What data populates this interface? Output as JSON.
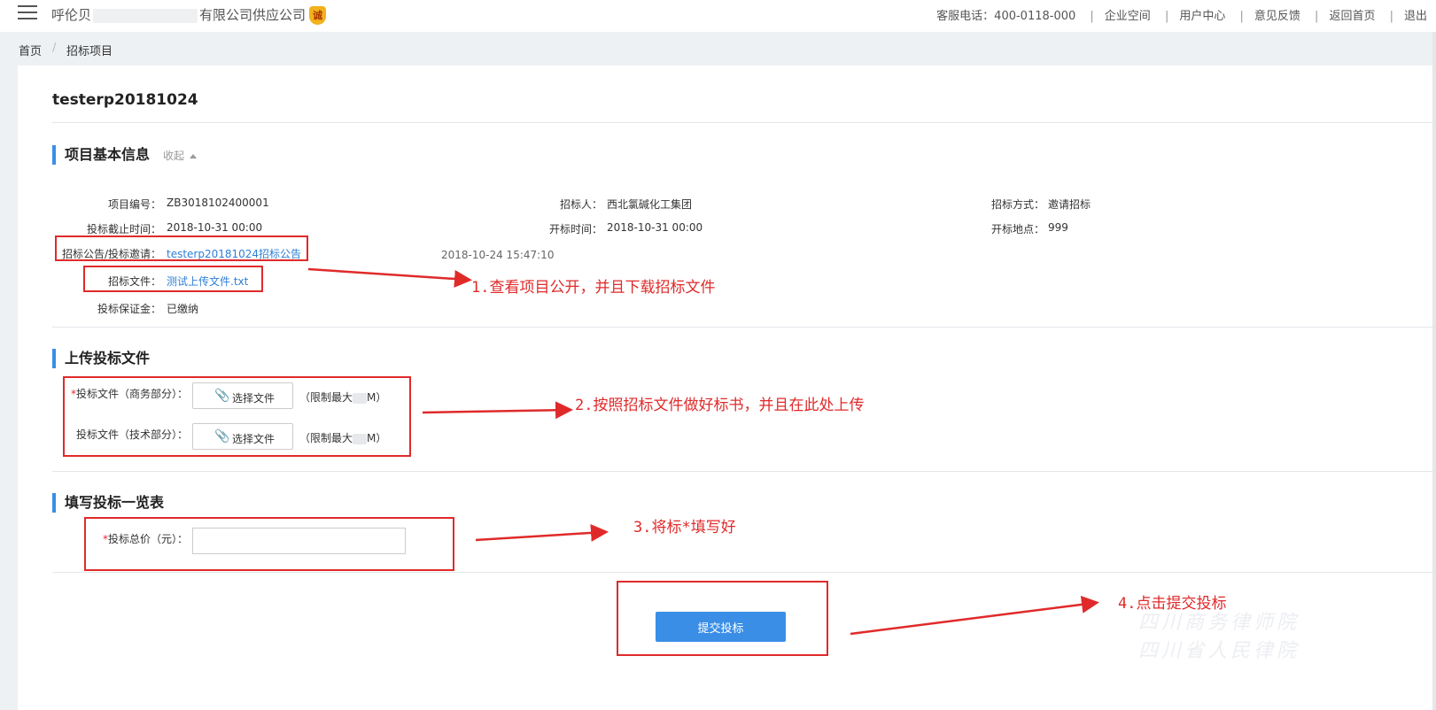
{
  "header": {
    "company_prefix": "呼伦贝",
    "company_suffix": "有限公司供应公司",
    "badge": "诚",
    "hotline": "客服电话：400-0118-000",
    "nav": [
      "企业空间",
      "用户中心",
      "意见反馈",
      "返回首页",
      "退出"
    ]
  },
  "breadcrumb": {
    "home": "首页",
    "current": "招标项目"
  },
  "project": {
    "title": "testerp20181024"
  },
  "basic_info": {
    "section_title": "项目基本信息",
    "collapse_label": "收起",
    "fields": {
      "project_no_label": "项目编号：",
      "project_no": "ZB3018102400001",
      "tenderer_label": "招标人：",
      "tenderer": "西北氯碱化工集团",
      "method_label": "招标方式：",
      "method": "邀请招标",
      "deadline_label": "投标截止时间：",
      "deadline": "2018-10-31 00:00",
      "open_time_label": "开标时间：",
      "open_time": "2018-10-31 00:00",
      "location_label": "开标地点：",
      "location": "999",
      "announcement_label": "招标公告/投标邀请：",
      "announcement": "testerp20181024招标公告",
      "announcement_date": "2018-10-24 15:47:10",
      "tender_file_label": "招标文件：",
      "tender_file": "测试上传文件.txt",
      "deposit_label": "投标保证金：",
      "deposit": "已缴纳"
    }
  },
  "upload": {
    "section_title": "上传投标文件",
    "commercial_label": "投标文件（商务部分）：",
    "technical_label": "投标文件（技术部分）：",
    "choose_file": "选择文件",
    "limit_prefix": "（限制最大",
    "limit_suffix": "M）",
    "required_mark": "*"
  },
  "summary": {
    "section_title": "填写投标一览表",
    "total_price_label": "投标总价（元）：",
    "total_price_value": ""
  },
  "submit_label": "提交投标",
  "annotations": {
    "step1": "1.查看项目公开，并且下载招标文件",
    "step2": "2.按照招标文件做好标书，并且在此处上传",
    "step3": "3.将标*填写好",
    "step4": "4.点击提交投标"
  },
  "watermark": [
    "四川商务律师院",
    "四川省人民律院"
  ],
  "colors": {
    "accent": "#3a8ee6",
    "annotation": "#e02a2a",
    "link": "#2d7fd6"
  }
}
